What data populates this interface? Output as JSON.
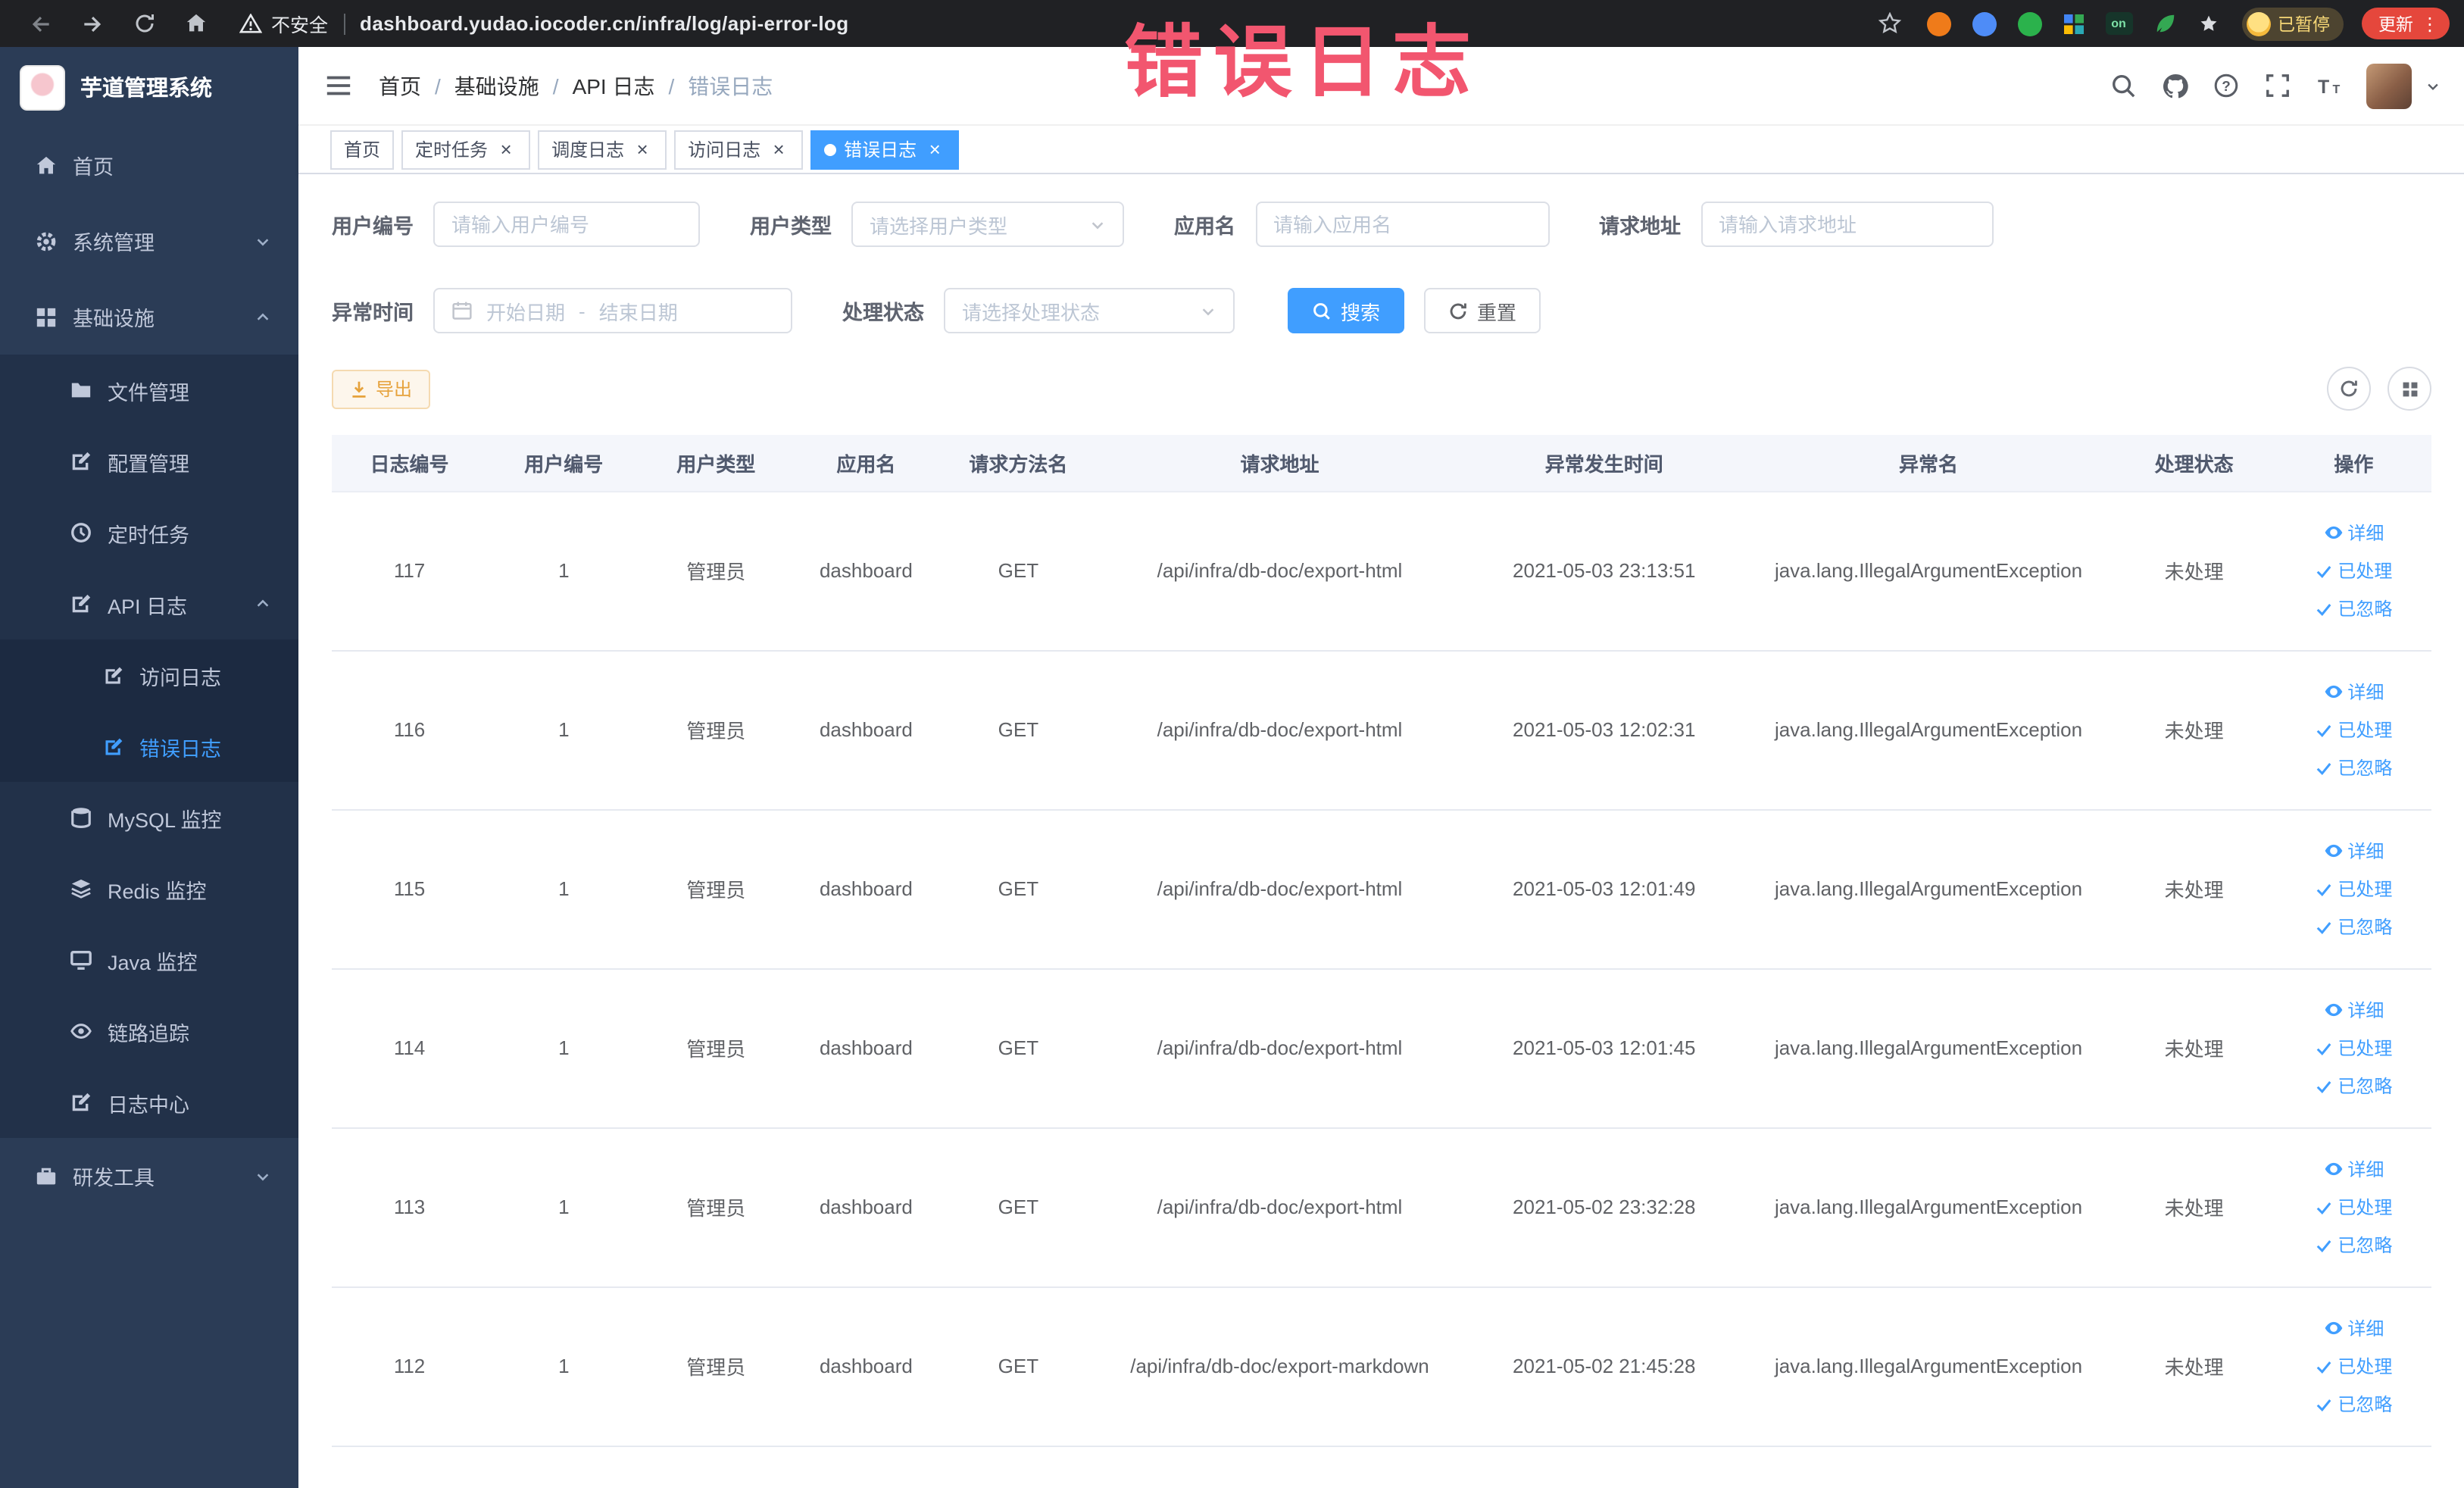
{
  "colors": {
    "accent": "#409eff",
    "annotation": "#f2566f",
    "warning": "#e6a23c",
    "sidebar_bg": "#2b3c56"
  },
  "browser": {
    "security_label": "不安全",
    "url": "dashboard.yudao.iocoder.cn/infra/log/api-error-log",
    "profile_badge": "已暂停",
    "update_button": "更新",
    "extension_on_badge": "on",
    "menu_dots": "⋮"
  },
  "sidebar": {
    "logo_title": "芋道管理系统",
    "items": [
      {
        "label": "首页"
      },
      {
        "label": "系统管理"
      },
      {
        "label": "基础设施"
      },
      {
        "label": "文件管理"
      },
      {
        "label": "配置管理"
      },
      {
        "label": "定时任务"
      },
      {
        "label": "API 日志"
      },
      {
        "label": "访问日志"
      },
      {
        "label": "错误日志"
      },
      {
        "label": "MySQL 监控"
      },
      {
        "label": "Redis 监控"
      },
      {
        "label": "Java 监控"
      },
      {
        "label": "链路追踪"
      },
      {
        "label": "日志中心"
      },
      {
        "label": "研发工具"
      }
    ]
  },
  "header": {
    "breadcrumb": [
      "首页",
      "基础设施",
      "API 日志",
      "错误日志"
    ],
    "separator": "/",
    "annotation": "错误日志"
  },
  "tabs": [
    {
      "label": "首页"
    },
    {
      "label": "定时任务"
    },
    {
      "label": "调度日志"
    },
    {
      "label": "访问日志"
    },
    {
      "label": "错误日志"
    }
  ],
  "filters": {
    "user_id": {
      "label": "用户编号",
      "placeholder": "请输入用户编号",
      "value": ""
    },
    "user_type": {
      "label": "用户类型",
      "placeholder": "请选择用户类型"
    },
    "app_name": {
      "label": "应用名",
      "placeholder": "请输入应用名",
      "value": ""
    },
    "request_url": {
      "label": "请求地址",
      "placeholder": "请输入请求地址",
      "value": ""
    },
    "exception_time": {
      "label": "异常时间",
      "start_placeholder": "开始日期",
      "separator": "-",
      "end_placeholder": "结束日期"
    },
    "process_status": {
      "label": "处理状态",
      "placeholder": "请选择处理状态"
    },
    "search_button": "搜索",
    "reset_button": "重置"
  },
  "toolbar": {
    "export_button": "导出"
  },
  "table": {
    "columns": [
      "日志编号",
      "用户编号",
      "用户类型",
      "应用名",
      "请求方法名",
      "请求地址",
      "异常发生时间",
      "异常名",
      "处理状态",
      "操作"
    ],
    "column_keys": [
      "log_id",
      "user_id",
      "user_type",
      "app_name",
      "method",
      "url",
      "time",
      "exception",
      "status"
    ],
    "rows": [
      [
        "117",
        "1",
        "管理员",
        "dashboard",
        "GET",
        "/api/infra/db-doc/export-html",
        "2021-05-03 23:13:51",
        "java.lang.IllegalArgumentException",
        "未处理"
      ],
      [
        "116",
        "1",
        "管理员",
        "dashboard",
        "GET",
        "/api/infra/db-doc/export-html",
        "2021-05-03 12:02:31",
        "java.lang.IllegalArgumentException",
        "未处理"
      ],
      [
        "115",
        "1",
        "管理员",
        "dashboard",
        "GET",
        "/api/infra/db-doc/export-html",
        "2021-05-03 12:01:49",
        "java.lang.IllegalArgumentException",
        "未处理"
      ],
      [
        "114",
        "1",
        "管理员",
        "dashboard",
        "GET",
        "/api/infra/db-doc/export-html",
        "2021-05-03 12:01:45",
        "java.lang.IllegalArgumentException",
        "未处理"
      ],
      [
        "113",
        "1",
        "管理员",
        "dashboard",
        "GET",
        "/api/infra/db-doc/export-html",
        "2021-05-02 23:32:28",
        "java.lang.IllegalArgumentException",
        "未处理"
      ],
      [
        "112",
        "1",
        "管理员",
        "dashboard",
        "GET",
        "/api/infra/db-doc/export-markdown",
        "2021-05-02 21:45:28",
        "java.lang.IllegalArgumentException",
        "未处理"
      ]
    ],
    "row_actions": [
      {
        "key": "detail",
        "label": "详细",
        "icon": "eye"
      },
      {
        "key": "processed",
        "label": "已处理",
        "icon": "check"
      },
      {
        "key": "ignored",
        "label": "已忽略",
        "icon": "check"
      }
    ]
  }
}
